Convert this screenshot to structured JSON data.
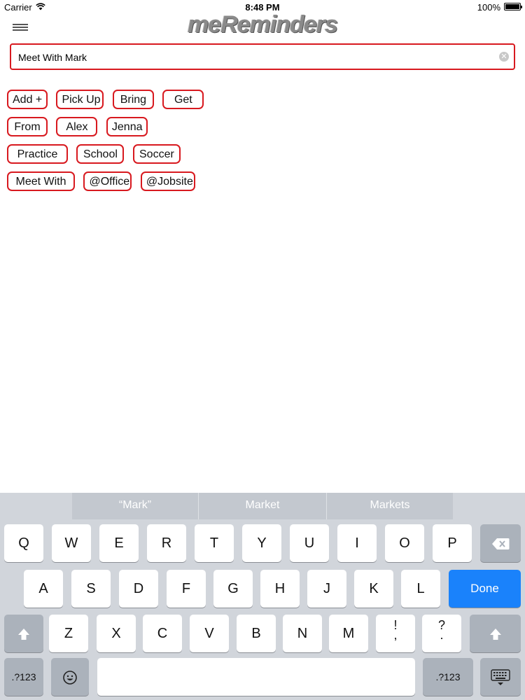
{
  "status_bar": {
    "carrier": "Carrier",
    "time": "8:48 PM",
    "battery": "100%"
  },
  "header": {
    "app_title": "meReminders"
  },
  "reminder_input": {
    "value": "Meet With Mark"
  },
  "chips": [
    [
      "Add +",
      "Pick Up",
      "Bring",
      "Get"
    ],
    [
      "From",
      "Alex",
      "Jenna"
    ],
    [
      "Practice",
      "School",
      "Soccer"
    ],
    [
      "Meet With",
      "@Office",
      "@Jobsite"
    ]
  ],
  "keyboard": {
    "suggestions": [
      "“Mark”",
      "Market",
      "Markets"
    ],
    "row1": [
      "Q",
      "W",
      "E",
      "R",
      "T",
      "Y",
      "U",
      "I",
      "O",
      "P"
    ],
    "row2": [
      "A",
      "S",
      "D",
      "F",
      "G",
      "H",
      "J",
      "K",
      "L"
    ],
    "row3": [
      "Z",
      "X",
      "C",
      "V",
      "B",
      "N",
      "M"
    ],
    "punct1": [
      "!",
      ","
    ],
    "punct2": [
      "?",
      "."
    ],
    "done_label": "Done",
    "numbers_label": ".?123",
    "backspace_icon": "backspace-icon",
    "shift_icon": "shift-icon",
    "emoji_icon": "emoji-icon",
    "hide_keyboard_icon": "hide-keyboard-icon",
    "accent_color": "#1a82fb"
  },
  "colors": {
    "chip_border": "#d8191f"
  }
}
